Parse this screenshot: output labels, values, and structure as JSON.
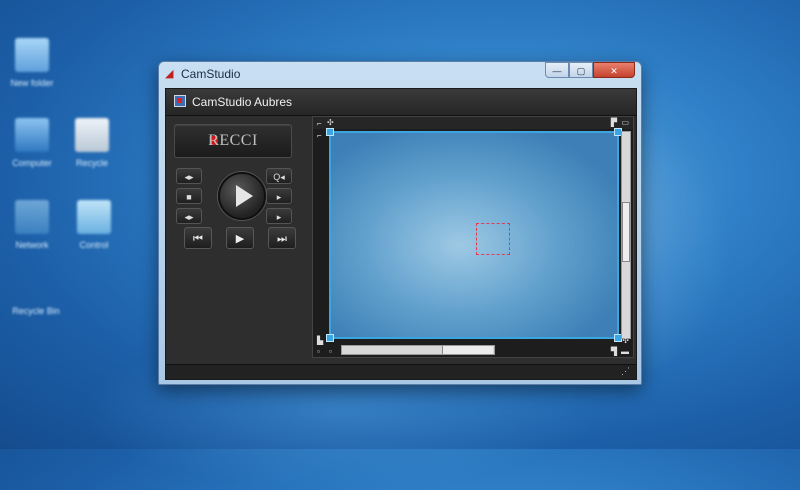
{
  "desktop": {
    "icons": [
      {
        "label": "New folder",
        "color": "#7cb8e8",
        "accent": "#4a9a30"
      },
      {
        "label": "Computer",
        "color": "#5fa0dc",
        "accent": "#3f8fcf"
      },
      {
        "label": "Recycle",
        "color": "#c9d6e2",
        "accent": "#d04040"
      },
      {
        "label": "Network",
        "color": "#8fc8ec",
        "accent": "#5a9fd6"
      },
      {
        "label": "Control",
        "color": "#9ad0f0",
        "accent": "#6ab0e0"
      },
      {
        "label": "Recycle Bin",
        "color": "#4a8fcc",
        "accent": "#4a8fcc"
      }
    ]
  },
  "window": {
    "title": "CamStudio",
    "buttons": {
      "minimize": "—",
      "maximize": "▢",
      "close": "✕"
    }
  },
  "app": {
    "header_title": "CamStudio Aubres",
    "record_label": "RECCI",
    "controls": {
      "left_top": "◂▸",
      "left_mid": "■",
      "left_bot": "◂▸",
      "right_top": "Q◂",
      "right_mid": "▸",
      "right_bot": "▸",
      "prev": "⏮",
      "play": "▶",
      "next": "⏭"
    }
  },
  "colors": {
    "accent": "#3aa5e0",
    "region": "#e23a52",
    "record": "#d01818"
  }
}
